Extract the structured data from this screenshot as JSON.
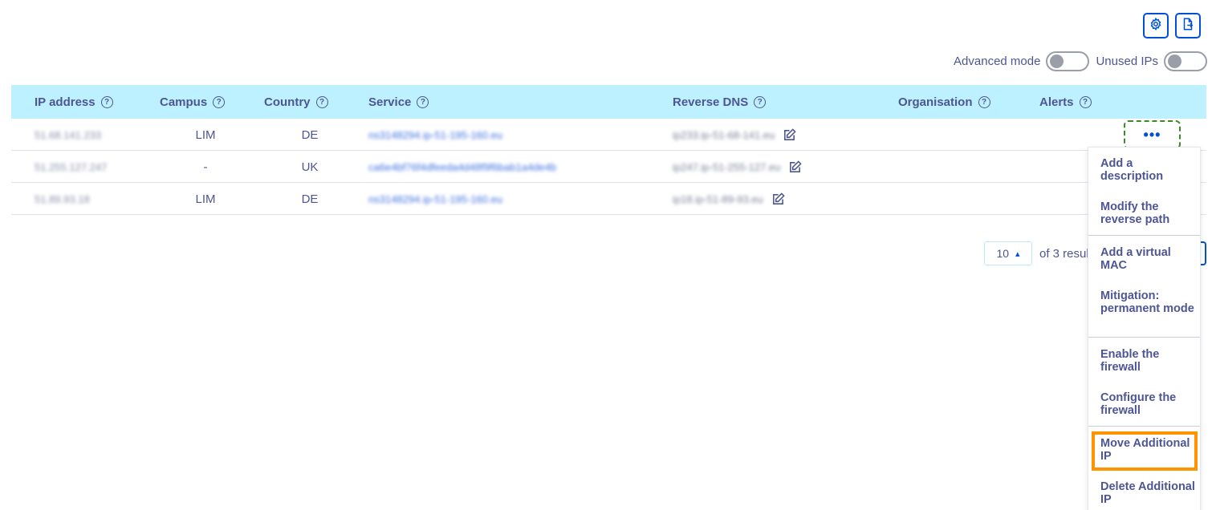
{
  "toolbar": {
    "icons": [
      "gear-icon",
      "export-icon"
    ]
  },
  "toggles": {
    "advanced_mode_label": "Advanced mode",
    "advanced_mode_on": false,
    "unused_ips_label": "Unused IPs",
    "unused_ips_on": false
  },
  "table": {
    "headers": {
      "ip": "IP address",
      "campus": "Campus",
      "country": "Country",
      "service": "Service",
      "reverse_dns": "Reverse DNS",
      "organisation": "Organisation",
      "alerts": "Alerts"
    },
    "help_glyph": "?",
    "rows": [
      {
        "ip": "51.68.141.233",
        "campus": "LIM",
        "country": "DE",
        "service": "ns3148294.ip-51-195-160.eu",
        "reverse_dns": "ip233.ip-51-68-141.eu"
      },
      {
        "ip": "51.255.127.247",
        "campus": "-",
        "country": "UK",
        "service": "ca6e4bf76f4dfeeda4d48f9f6bab1a4de4b",
        "reverse_dns": "ip247.ip-51-255-127.eu"
      },
      {
        "ip": "51.89.93.18",
        "campus": "LIM",
        "country": "DE",
        "service": "ns3148294.ip-51-195-160.eu",
        "reverse_dns": "ip18.ip-51-89-93.eu"
      }
    ],
    "more_label": "•••"
  },
  "pagination": {
    "page_size": "10",
    "results_text": "of 3 resul"
  },
  "menu": {
    "items": [
      "Add a description",
      "Modify the reverse path",
      "Add a virtual MAC",
      "Mitigation: permanent mode",
      "Enable the firewall",
      "Configure the firewall",
      "Move Additional IP",
      "Delete Additional IP"
    ],
    "highlighted_index": 6
  },
  "colors": {
    "accent": "#0050d7",
    "header_bg": "#bef1ff",
    "text": "#4d5693",
    "highlight": "#ff9400",
    "focus_dashed": "#3b8a2a"
  }
}
